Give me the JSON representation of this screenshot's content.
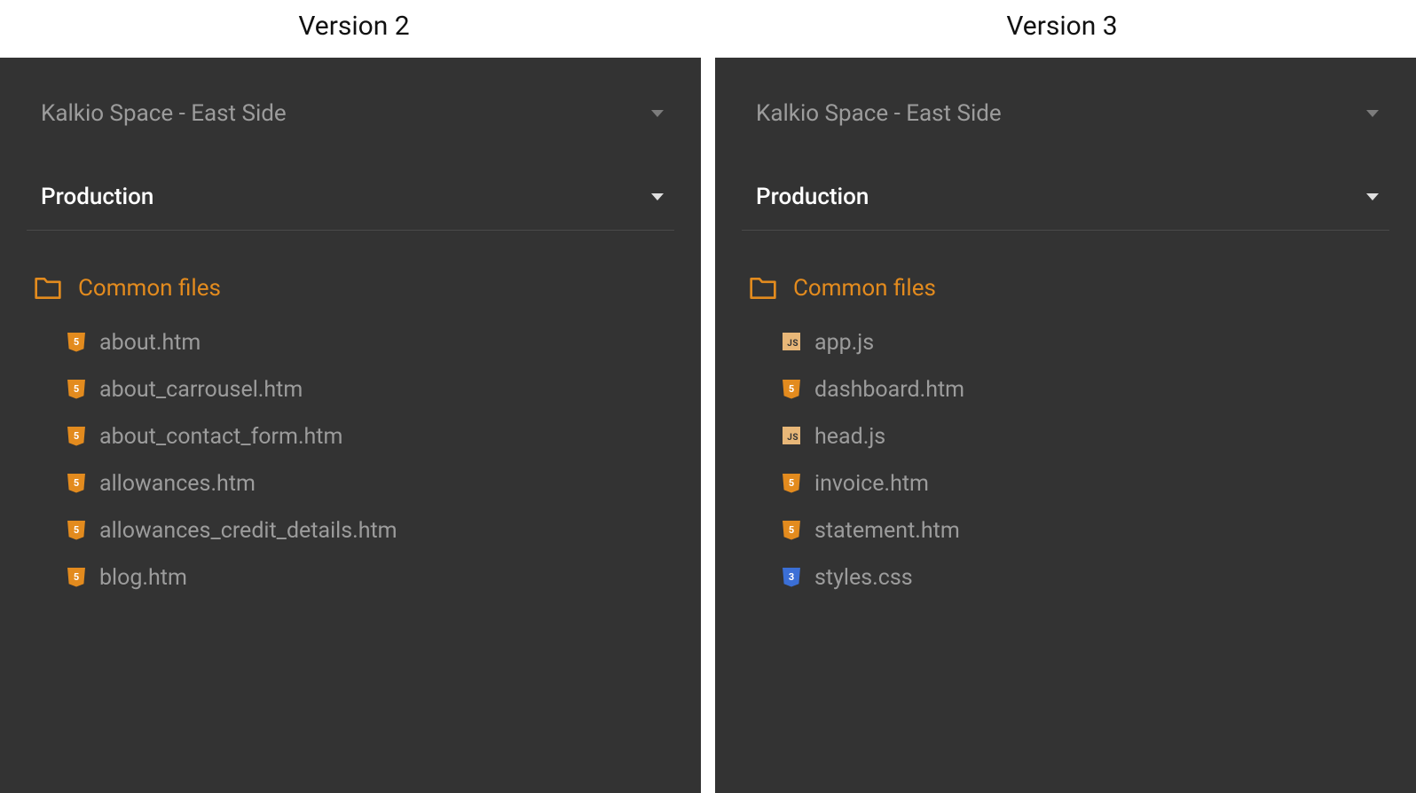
{
  "columns": [
    {
      "title": "Version 2",
      "project": "Kalkio Space - East Side",
      "environment": "Production",
      "folder": "Common files",
      "files": [
        {
          "name": "about.htm",
          "type": "html"
        },
        {
          "name": "about_carrousel.htm",
          "type": "html"
        },
        {
          "name": "about_contact_form.htm",
          "type": "html"
        },
        {
          "name": "allowances.htm",
          "type": "html"
        },
        {
          "name": "allowances_credit_details.htm",
          "type": "html"
        },
        {
          "name": "blog.htm",
          "type": "html"
        }
      ]
    },
    {
      "title": "Version 3",
      "project": "Kalkio Space - East Side",
      "environment": "Production",
      "folder": "Common files",
      "files": [
        {
          "name": "app.js",
          "type": "js"
        },
        {
          "name": "dashboard.htm",
          "type": "html"
        },
        {
          "name": "head.js",
          "type": "js"
        },
        {
          "name": "invoice.htm",
          "type": "html"
        },
        {
          "name": "statement.htm",
          "type": "html"
        },
        {
          "name": "styles.css",
          "type": "css"
        }
      ]
    }
  ],
  "colors": {
    "panel_bg": "#333333",
    "accent_orange": "#e38b1e",
    "text_muted": "#9c9c9c",
    "text_white": "#ffffff",
    "css_blue": "#3b6fd6",
    "js_tan": "#e8b778"
  }
}
